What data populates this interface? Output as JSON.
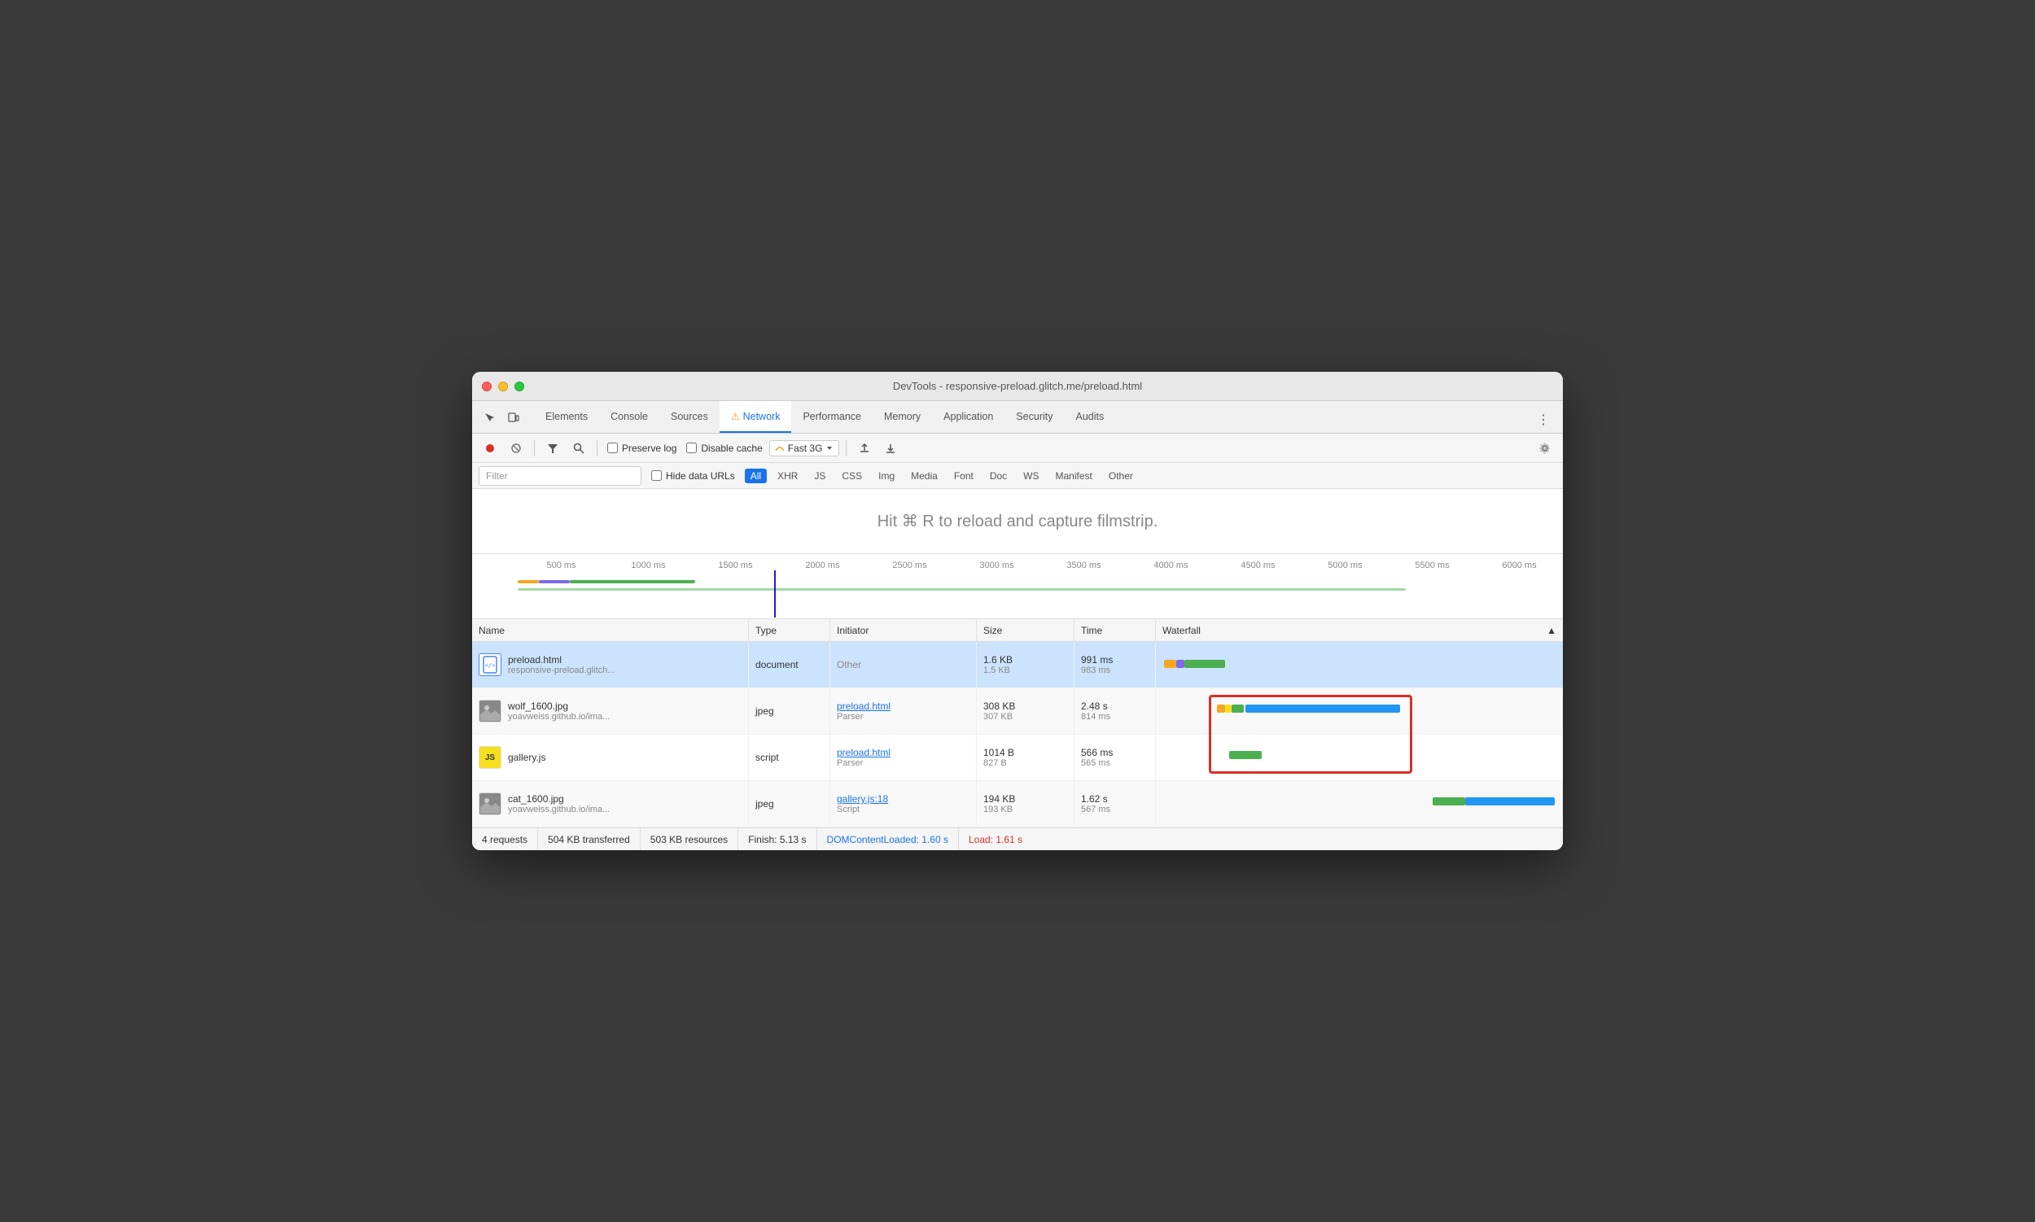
{
  "window": {
    "title": "DevTools - responsive-preload.glitch.me/preload.html"
  },
  "tabs": [
    {
      "id": "elements",
      "label": "Elements",
      "active": false
    },
    {
      "id": "console",
      "label": "Console",
      "active": false
    },
    {
      "id": "sources",
      "label": "Sources",
      "active": false
    },
    {
      "id": "network",
      "label": "Network",
      "active": true,
      "warning": true
    },
    {
      "id": "performance",
      "label": "Performance",
      "active": false
    },
    {
      "id": "memory",
      "label": "Memory",
      "active": false
    },
    {
      "id": "application",
      "label": "Application",
      "active": false
    },
    {
      "id": "security",
      "label": "Security",
      "active": false
    },
    {
      "id": "audits",
      "label": "Audits",
      "active": false
    }
  ],
  "toolbar": {
    "record_title": "Record network log",
    "clear_title": "Clear",
    "filter_title": "Filter",
    "search_title": "Search",
    "preserve_log_label": "Preserve log",
    "disable_cache_label": "Disable cache",
    "throttle_label": "Fast 3G",
    "import_title": "Import HAR file",
    "export_title": "Export HAR file",
    "settings_title": "Network settings"
  },
  "filter_bar": {
    "placeholder": "Filter",
    "hide_data_urls": "Hide data URLs",
    "buttons": [
      "All",
      "XHR",
      "JS",
      "CSS",
      "Img",
      "Media",
      "Font",
      "Doc",
      "WS",
      "Manifest",
      "Other"
    ]
  },
  "filmstrip": {
    "message": "Hit ⌘ R to reload and capture filmstrip."
  },
  "timeline": {
    "labels": [
      "500 ms",
      "1000 ms",
      "1500 ms",
      "2000 ms",
      "2500 ms",
      "3000 ms",
      "3500 ms",
      "4000 ms",
      "4500 ms",
      "5000 ms",
      "5500 ms",
      "6000 ms"
    ],
    "vertical_line_pos_pct": 28
  },
  "table": {
    "headers": [
      "Name",
      "Type",
      "Initiator",
      "Size",
      "Time",
      "Waterfall"
    ],
    "rows": [
      {
        "id": "preload-html",
        "name": "preload.html",
        "domain": "responsive-preload.glitch...",
        "type": "document",
        "initiator": "Other",
        "initiator_link": false,
        "size_transfer": "1.6 KB",
        "size_resource": "1.5 KB",
        "time_total": "991 ms",
        "time_latency": "983 ms",
        "selected": true,
        "icon": "html"
      },
      {
        "id": "wolf-jpg",
        "name": "wolf_1600.jpg",
        "domain": "yoavweiss.github.io/ima...",
        "type": "jpeg",
        "initiator": "preload.html",
        "initiator_sub": "Parser",
        "initiator_link": true,
        "size_transfer": "308 KB",
        "size_resource": "307 KB",
        "time_total": "2.48 s",
        "time_latency": "814 ms",
        "selected": false,
        "icon": "img"
      },
      {
        "id": "gallery-js",
        "name": "gallery.js",
        "domain": "",
        "type": "script",
        "initiator": "preload.html",
        "initiator_sub": "Parser",
        "initiator_link": true,
        "size_transfer": "1014 B",
        "size_resource": "827 B",
        "time_total": "566 ms",
        "time_latency": "565 ms",
        "selected": false,
        "icon": "js"
      },
      {
        "id": "cat-jpg",
        "name": "cat_1600.jpg",
        "domain": "yoavweiss.github.io/ima...",
        "type": "jpeg",
        "initiator": "gallery.js:18",
        "initiator_sub": "Script",
        "initiator_link": true,
        "size_transfer": "194 KB",
        "size_resource": "193 KB",
        "time_total": "1.62 s",
        "time_latency": "567 ms",
        "selected": false,
        "icon": "img"
      }
    ]
  },
  "status_bar": {
    "requests": "4 requests",
    "transferred": "504 KB transferred",
    "resources": "503 KB resources",
    "finish": "Finish: 5.13 s",
    "dom_content_loaded": "DOMContentLoaded: 1.60 s",
    "load": "Load: 1.61 s"
  }
}
